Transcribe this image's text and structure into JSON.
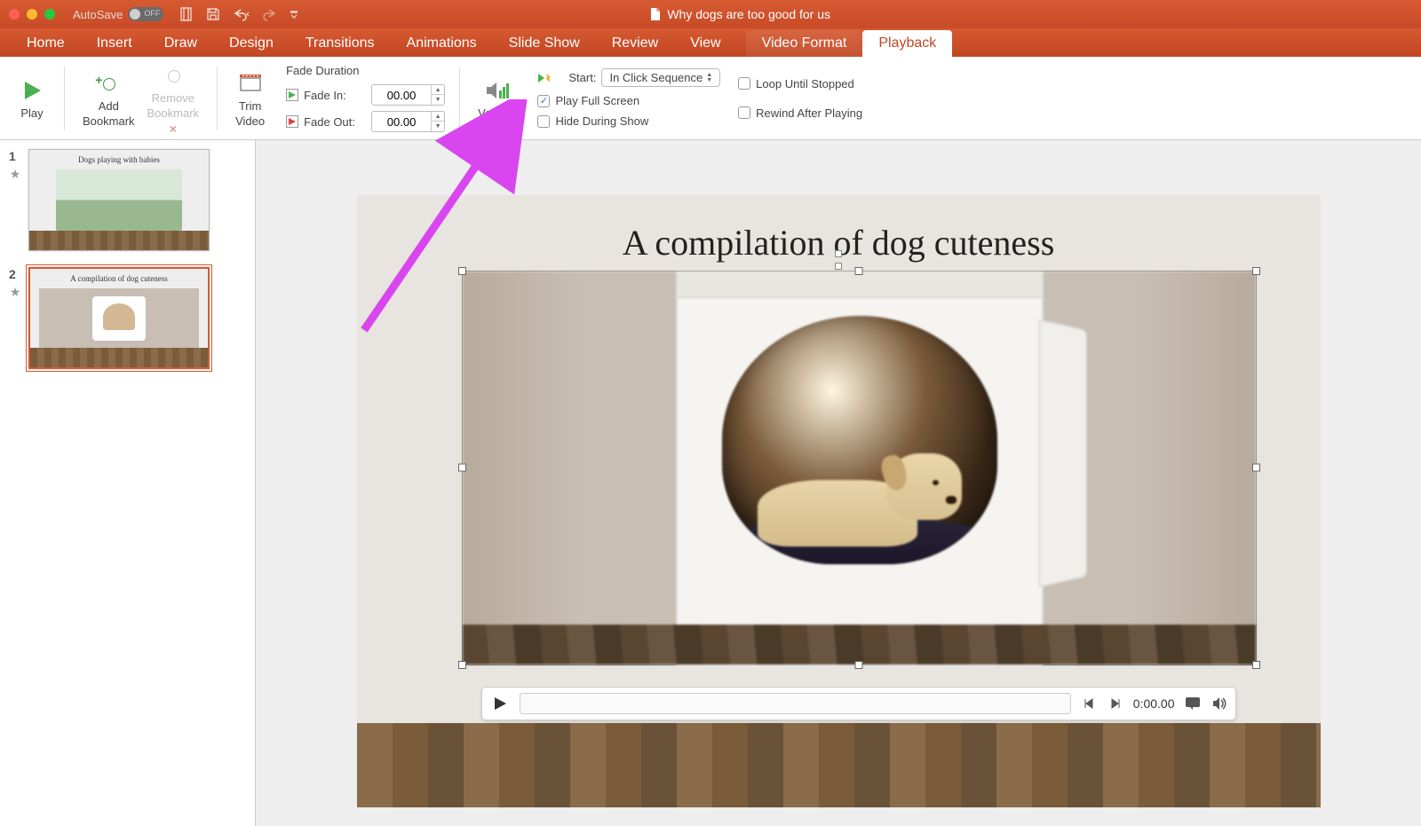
{
  "window": {
    "autosave_label": "AutoSave",
    "autosave_state": "OFF",
    "doc_title": "Why dogs are too good for us"
  },
  "tabs": {
    "home": "Home",
    "insert": "Insert",
    "draw": "Draw",
    "design": "Design",
    "transitions": "Transitions",
    "animations": "Animations",
    "slideshow": "Slide Show",
    "review": "Review",
    "view": "View",
    "video_format": "Video Format",
    "playback": "Playback"
  },
  "ribbon": {
    "play": "Play",
    "add_bookmark_l1": "Add",
    "add_bookmark_l2": "Bookmark",
    "remove_bookmark_l1": "Remove",
    "remove_bookmark_l2": "Bookmark",
    "trim_l1": "Trim",
    "trim_l2": "Video",
    "fade_duration": "Fade Duration",
    "fade_in_label": "Fade In:",
    "fade_out_label": "Fade Out:",
    "fade_in_value": "00.00",
    "fade_out_value": "00.00",
    "volume": "Volume",
    "start_label": "Start:",
    "start_value": "In Click Sequence",
    "play_full_screen": "Play Full Screen",
    "hide_during_show": "Hide During Show",
    "loop_until_stopped": "Loop Until Stopped",
    "rewind_after_playing": "Rewind After Playing"
  },
  "thumbnails": {
    "slide1_num": "1",
    "slide1_title": "Dogs playing with babies",
    "slide2_num": "2",
    "slide2_title": "A compilation of dog cuteness"
  },
  "slide": {
    "title": "A compilation of dog cuteness"
  },
  "player": {
    "time": "0:00.00"
  }
}
